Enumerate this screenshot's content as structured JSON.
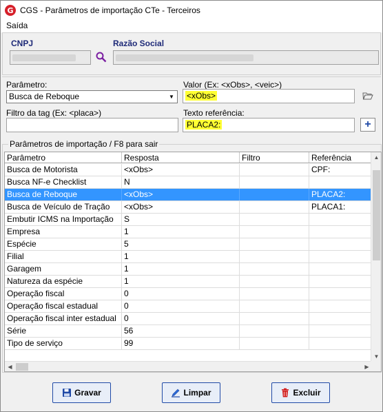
{
  "window": {
    "title": "CGS - Parâmetros de importação CTe - Terceiros"
  },
  "menu": {
    "items": [
      "Saída"
    ]
  },
  "header": {
    "cnpj_label": "CNPJ",
    "razao_label": "Razão Social"
  },
  "filter": {
    "parametro_label": "Parâmetro:",
    "parametro_value": "Busca de Reboque",
    "valor_label": "Valor (Ex: <xObs>, <veic>)",
    "valor_value": "<xObs>",
    "filtro_label": "Filtro da tag (Ex: <placa>)",
    "filtro_value": "",
    "texto_label": "Texto referência:",
    "texto_value": "PLACA2:"
  },
  "grid": {
    "group_title": "Parâmetros de importação /  F8 para sair",
    "columns": [
      "Parâmetro",
      "Resposta",
      "Filtro",
      "Referência"
    ],
    "rows": [
      [
        "Busca de Motorista",
        "<xObs>",
        "",
        "CPF:"
      ],
      [
        "Busca NF-e Checklist",
        "N",
        "",
        ""
      ],
      [
        "Busca de Reboque",
        "<xObs>",
        "",
        "PLACA2:"
      ],
      [
        "Busca de Veículo de Tração",
        "<xObs>",
        "",
        "PLACA1:"
      ],
      [
        "Embutir ICMS na Importação",
        "S",
        "",
        ""
      ],
      [
        "Empresa",
        "1",
        "",
        ""
      ],
      [
        "Espécie",
        "5",
        "",
        ""
      ],
      [
        "Filial",
        "1",
        "",
        ""
      ],
      [
        "Garagem",
        "1",
        "",
        ""
      ],
      [
        "Natureza da espécie",
        "1",
        "",
        ""
      ],
      [
        "Operação fiscal",
        "0",
        "",
        ""
      ],
      [
        "Operação fiscal estadual",
        "0",
        "",
        ""
      ],
      [
        "Operação fiscal inter estadual",
        "0",
        "",
        ""
      ],
      [
        "Série",
        "56",
        "",
        ""
      ],
      [
        "Tipo de serviço",
        "99",
        "",
        ""
      ]
    ],
    "selected_row": 2
  },
  "buttons": {
    "gravar": "Gravar",
    "limpar": "Limpar",
    "excluir": "Excluir"
  },
  "colors": {
    "selection": "#3395ff",
    "highlight": "#ffff33",
    "label_blue": "#1e2a78",
    "button_border": "#1f49a6"
  },
  "icons": {
    "app": "cgs-logo-icon",
    "search": "magnifier-icon",
    "folder": "open-folder-icon",
    "add": "plus-icon",
    "save": "floppy-disk-icon",
    "clear": "pencil-icon",
    "delete": "trash-icon"
  }
}
